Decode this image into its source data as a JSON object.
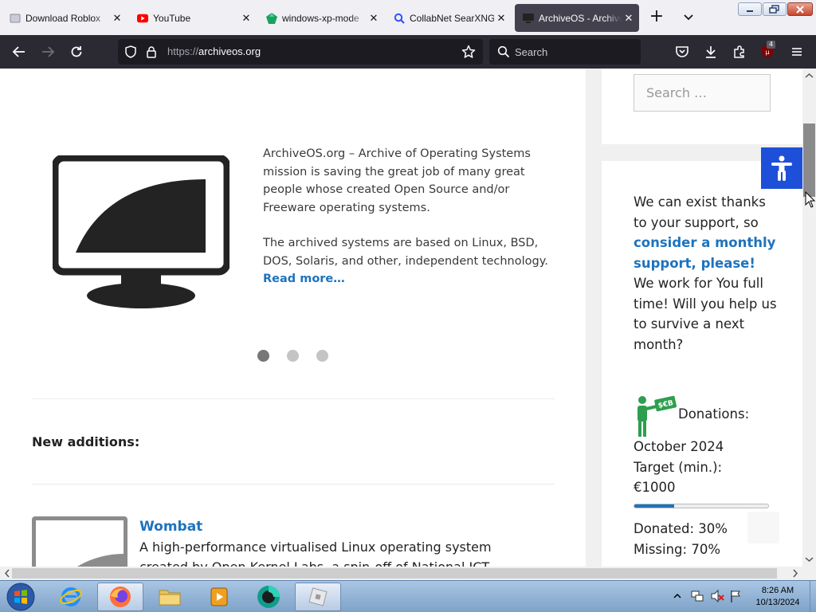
{
  "browser": {
    "tabs": [
      {
        "title": "Download Roblox",
        "icon": "roblox-page-icon"
      },
      {
        "title": "YouTube",
        "icon": "youtube-icon"
      },
      {
        "title": "windows-xp-mode",
        "icon": "gem-icon"
      },
      {
        "title": "CollabNet SearXNG",
        "icon": "searxng-icon"
      },
      {
        "title": "ArchiveOS - Archive",
        "icon": "archiveos-icon",
        "active": true
      }
    ],
    "new_tab_label": "+",
    "url_protocol": "https://",
    "url_host": "archiveos.org",
    "search_placeholder": "Search",
    "extension_badge": "4"
  },
  "page": {
    "hero": {
      "paragraph_1": "ArchiveOS.org – Archive of Operating Systems mission is saving the great job of many great people whose created Open Source and/or Freeware operating systems.",
      "paragraph_2": "The archived systems are based on Linux, BSD, DOS, Solaris, and other, independent technology.",
      "read_more": "Read more…"
    },
    "slider_dots": 3,
    "slider_active_index": 0,
    "new_additions_heading": "New additions:",
    "entry": {
      "title": "Wombat",
      "description": "A high-performance virtualised Linux operating system created by Open Kernel Labs, a spin-off of National ICT"
    },
    "sidebar": {
      "search_placeholder": "Search …",
      "support_text_1": "We can exist thanks to your support, so",
      "support_link": "consider a monthly support, please!",
      "support_text_2": "We work for You full time! Will you help us to survive a next month?",
      "donations_label": "Donations:",
      "donation_month": "October 2024",
      "target_label": "Target (min.):",
      "target_value": "€1000",
      "donated_pct": 30,
      "donated_text": "Donated: 30%",
      "missing_text": "Missing: 70%"
    }
  },
  "taskbar": {
    "time": "8:26 AM",
    "date": "10/13/2024"
  },
  "colors": {
    "accent": "#1e73be",
    "a11y_button": "#1e4fd8",
    "donation_green": "#2e9e4f"
  }
}
